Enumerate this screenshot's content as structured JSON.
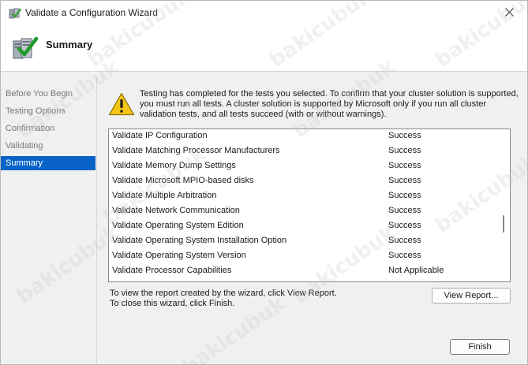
{
  "window": {
    "title": "Validate a Configuration Wizard"
  },
  "header": {
    "title": "Summary"
  },
  "nav": {
    "items": [
      {
        "label": "Before You Begin",
        "active": false
      },
      {
        "label": "Testing Options",
        "active": false
      },
      {
        "label": "Confirmation",
        "active": false
      },
      {
        "label": "Validating",
        "active": false
      },
      {
        "label": "Summary",
        "active": true
      }
    ]
  },
  "message": {
    "text": "Testing has completed for the tests you selected. To confirm that your cluster solution is supported, you must run all tests.  A cluster solution is supported by Microsoft only if you run all cluster validation tests, and all tests succeed (with or without warnings)."
  },
  "report": {
    "rows": [
      {
        "name": "Validate IP Configuration",
        "result": "Success"
      },
      {
        "name": "Validate Matching Processor Manufacturers",
        "result": "Success"
      },
      {
        "name": "Validate Memory Dump Settings",
        "result": "Success"
      },
      {
        "name": "Validate Microsoft MPIO-based disks",
        "result": "Success"
      },
      {
        "name": "Validate Multiple Arbitration",
        "result": "Success"
      },
      {
        "name": "Validate Network Communication",
        "result": "Success"
      },
      {
        "name": "Validate Operating System Edition",
        "result": "Success"
      },
      {
        "name": "Validate Operating System Installation Option",
        "result": "Success"
      },
      {
        "name": "Validate Operating System Version",
        "result": "Success"
      },
      {
        "name": "Validate Processor Capabilities",
        "result": "Not Applicable"
      }
    ]
  },
  "footer": {
    "line1": "To view the report created by the wizard, click View Report.",
    "line2": "To close this wizard, click Finish.",
    "view_report_label": "View Report...",
    "finish_label": "Finish"
  },
  "watermark": {
    "text": "bakicubuk"
  },
  "colors": {
    "selected": "#0a64c8",
    "nav_inactive_text": "#777777",
    "window_bg": "#f0f0f0"
  },
  "icons": {
    "title": "cluster-validate-icon",
    "header": "cluster-check-icon",
    "warning": "warning-icon",
    "close": "close-icon"
  }
}
